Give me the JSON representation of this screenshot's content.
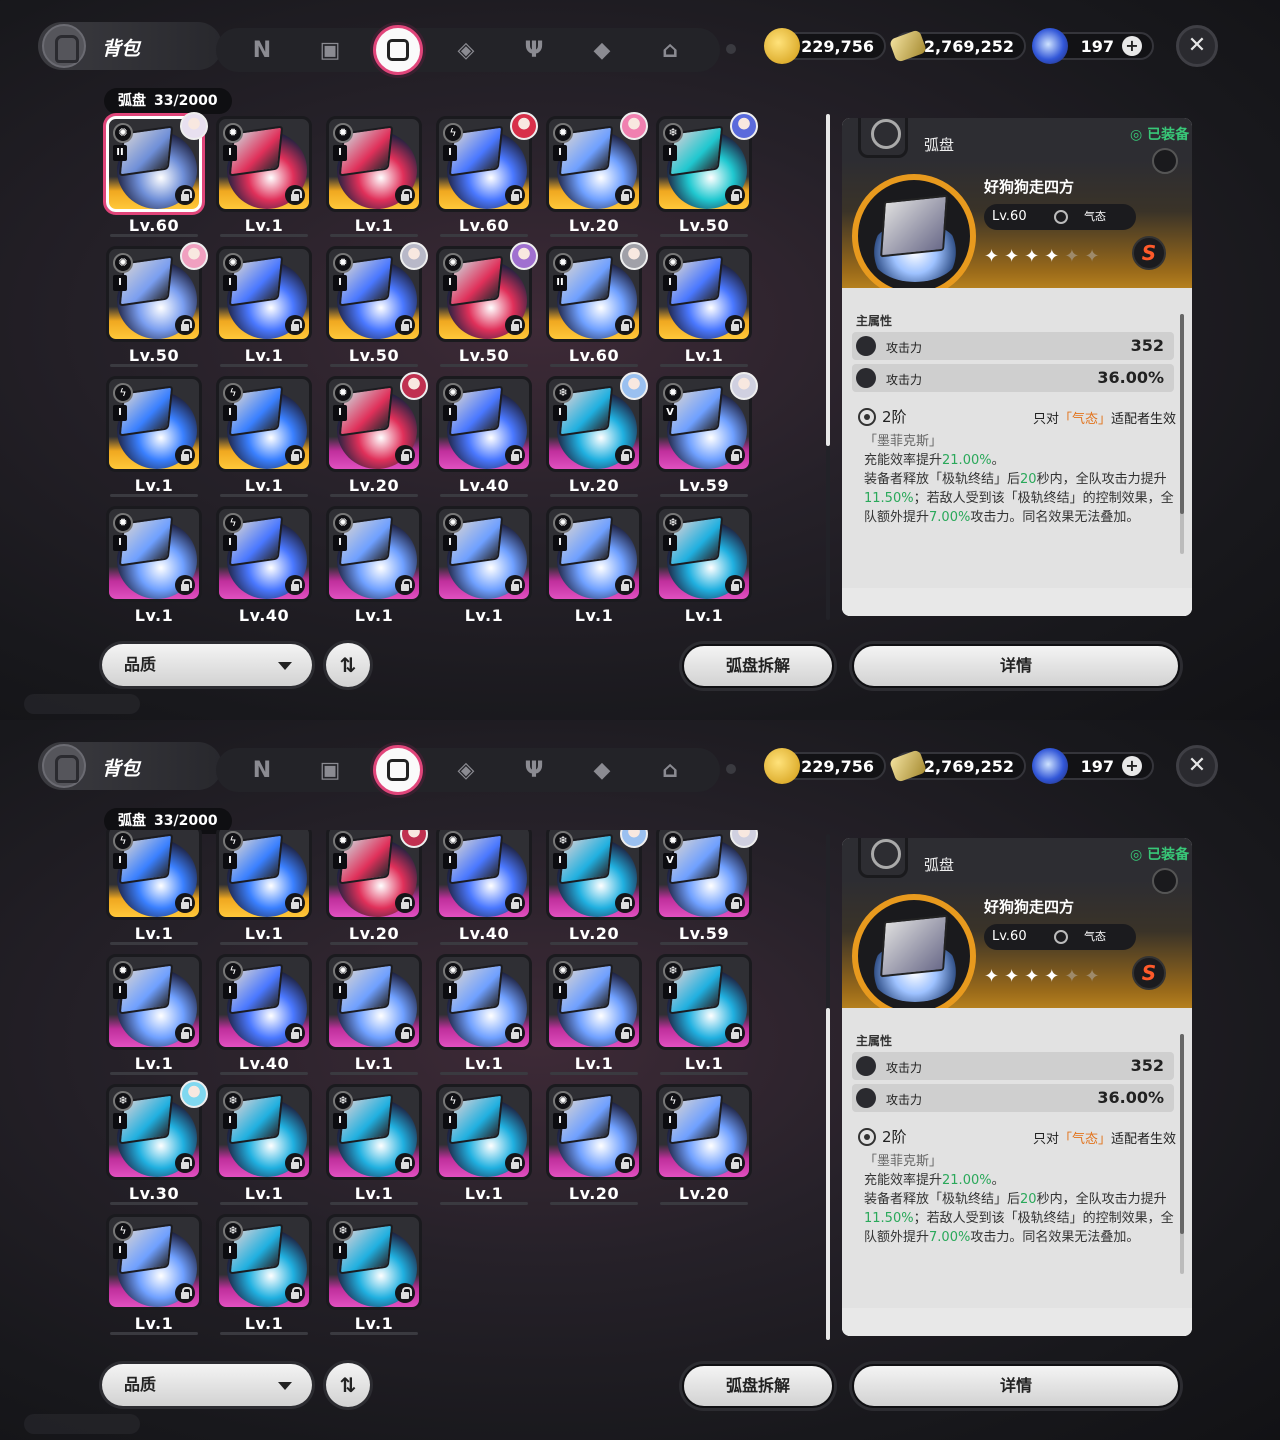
{
  "header": {
    "title": "背包",
    "tabs": [
      {
        "name": "tab-agents",
        "icon": "n-logo-icon",
        "glyph": "N"
      },
      {
        "name": "tab-device",
        "icon": "gameboy-icon",
        "glyph": ""
      },
      {
        "name": "tab-discs",
        "icon": "disc-drive-icon",
        "glyph": "",
        "active": true
      },
      {
        "name": "tab-materials",
        "icon": "cube-icon",
        "glyph": ""
      },
      {
        "name": "tab-food",
        "icon": "fork-knife-icon",
        "glyph": ""
      },
      {
        "name": "tab-bangboo",
        "icon": "box-stack-icon",
        "glyph": ""
      },
      {
        "name": "tab-home",
        "icon": "house-icon",
        "glyph": ""
      }
    ],
    "currencies": [
      {
        "name": "dennies",
        "icon": "gold-coin-icon",
        "value": "229,756"
      },
      {
        "name": "ticket",
        "icon": "ticket-icon",
        "value": "2,769,252"
      },
      {
        "name": "polychrome",
        "icon": "blue-gem-icon",
        "value": "197",
        "plus": "+"
      }
    ],
    "close_label": "✕"
  },
  "inventory": {
    "category": "弧盘",
    "count": "33/2000",
    "items": [
      {
        "level": "Lv.60",
        "grade": "A",
        "rank": "II",
        "hue": "#6f8fd8",
        "avatar": "#e8e0f0",
        "attr": "ether"
      },
      {
        "level": "Lv.1",
        "grade": "A",
        "rank": "I",
        "hue": "#e0305a",
        "attr": "physical"
      },
      {
        "level": "Lv.1",
        "grade": "A",
        "rank": "I",
        "hue": "#e0305a",
        "attr": "physical"
      },
      {
        "level": "Lv.60",
        "grade": "A",
        "rank": "I",
        "hue": "#4a78ff",
        "avatar": "#d8304a",
        "attr": "electric"
      },
      {
        "level": "Lv.20",
        "grade": "A",
        "rank": "I",
        "hue": "#6fa0ff",
        "avatar": "#f080b0",
        "attr": "physical"
      },
      {
        "level": "Lv.50",
        "grade": "A",
        "rank": "I",
        "hue": "#20c8d0",
        "avatar": "#5a6adc",
        "attr": "ice"
      },
      {
        "level": "Lv.50",
        "grade": "A",
        "rank": "I",
        "hue": "#7a9ef0",
        "avatar": "#f0a0c0",
        "attr": "ether"
      },
      {
        "level": "Lv.1",
        "grade": "A",
        "rank": "I",
        "hue": "#4a78ff",
        "attr": "ether"
      },
      {
        "level": "Lv.50",
        "grade": "A",
        "rank": "I",
        "hue": "#4a78ff",
        "avatar": "#b8b8c8",
        "attr": "physical"
      },
      {
        "level": "Lv.50",
        "grade": "A",
        "rank": "I",
        "hue": "#e0305a",
        "avatar": "#a070d0",
        "attr": "ether"
      },
      {
        "level": "Lv.60",
        "grade": "A",
        "rank": "II",
        "hue": "#6fa0ff",
        "avatar": "#a0a0a8",
        "attr": "physical"
      },
      {
        "level": "Lv.1",
        "grade": "A",
        "rank": "I",
        "hue": "#4a78ff",
        "attr": "ether"
      },
      {
        "level": "Lv.1",
        "grade": "A",
        "rank": "I",
        "hue": "#3a80ff",
        "attr": "electric"
      },
      {
        "level": "Lv.1",
        "grade": "A",
        "rank": "I",
        "hue": "#3a80ff",
        "attr": "electric"
      },
      {
        "level": "Lv.20",
        "grade": "S",
        "rank": "I",
        "hue": "#e0305a",
        "avatar": "#c03050",
        "attr": "physical"
      },
      {
        "level": "Lv.40",
        "grade": "S",
        "rank": "I",
        "hue": "#4a78ff",
        "attr": "ether"
      },
      {
        "level": "Lv.20",
        "grade": "S",
        "rank": "I",
        "hue": "#20b0e0",
        "avatar": "#9ac0f0",
        "attr": "ice"
      },
      {
        "level": "Lv.59",
        "grade": "S",
        "rank": "V",
        "hue": "#6fa0ff",
        "avatar": "#d0d0e0",
        "attr": "physical"
      },
      {
        "level": "Lv.1",
        "grade": "S",
        "rank": "I",
        "hue": "#6fa0ff",
        "attr": "physical"
      },
      {
        "level": "Lv.40",
        "grade": "S",
        "rank": "I",
        "hue": "#4a78ff",
        "attr": "electric"
      },
      {
        "level": "Lv.1",
        "grade": "S",
        "rank": "I",
        "hue": "#6fa0ff",
        "attr": "ether"
      },
      {
        "level": "Lv.1",
        "grade": "S",
        "rank": "I",
        "hue": "#6fa0ff",
        "attr": "ether"
      },
      {
        "level": "Lv.1",
        "grade": "S",
        "rank": "I",
        "hue": "#6fa0ff",
        "attr": "ether"
      },
      {
        "level": "Lv.1",
        "grade": "S",
        "rank": "I",
        "hue": "#20b0e0",
        "attr": "ice"
      },
      {
        "level": "Lv.30",
        "grade": "S",
        "rank": "I",
        "hue": "#20b0e0",
        "avatar": "#80d8f0",
        "attr": "ice"
      },
      {
        "level": "Lv.1",
        "grade": "S",
        "rank": "I",
        "hue": "#20b0e0",
        "attr": "ice"
      },
      {
        "level": "Lv.1",
        "grade": "S",
        "rank": "I",
        "hue": "#20b0e0",
        "attr": "ice"
      },
      {
        "level": "Lv.1",
        "grade": "S",
        "rank": "I",
        "hue": "#20b0e0",
        "attr": "electric"
      },
      {
        "level": "Lv.20",
        "grade": "S",
        "rank": "I",
        "hue": "#6fa0ff",
        "attr": "ether"
      },
      {
        "level": "Lv.20",
        "grade": "S",
        "rank": "I",
        "hue": "#6fa0ff",
        "attr": "electric"
      },
      {
        "level": "Lv.1",
        "grade": "S",
        "rank": "I",
        "hue": "#6fa0ff",
        "attr": "electric"
      },
      {
        "level": "Lv.1",
        "grade": "S",
        "rank": "I",
        "hue": "#20b0e0",
        "attr": "ice"
      },
      {
        "level": "Lv.1",
        "grade": "S",
        "rank": "I",
        "hue": "#20b0e0",
        "attr": "ice"
      }
    ]
  },
  "detail": {
    "type_label": "弧盘",
    "equipped_label": "◎ 已装备",
    "name": "好狗狗走四方",
    "level": "Lv.60",
    "stance": "气态",
    "stars_filled": 4,
    "stars_total": 6,
    "grade_badge": "S",
    "main_stat_label": "主属性",
    "stats": [
      {
        "name": "攻击力",
        "value": "352"
      },
      {
        "name": "攻击力",
        "value": "36.00%"
      }
    ],
    "tier": "2阶",
    "condition_pre": "只对",
    "condition_hl": "「气态」",
    "condition_post": "适配者生效",
    "quote": "「墨菲克斯」",
    "line1_pre": "充能效率提升",
    "line1_v": "21.00%",
    "line1_post": "。",
    "line2_a": "装备者释放「极轨终结」后",
    "line2_v1": "20",
    "line2_b": "秒内，全队攻击力提升",
    "line2_v2": "11.50%",
    "line2_c": "；若敌人受到该「极轨终结」的控制效果，全队额外提升",
    "line2_v3": "7.00%",
    "line2_d": "攻击力。同名效果无法叠加。"
  },
  "footer": {
    "filter_label": "品质",
    "sort_label": "⇅",
    "dismantle_label": "弧盘拆解",
    "details_label": "详情"
  },
  "colors": {
    "accent": "#e0457a",
    "equipped": "#38c878",
    "highlight": "#e2731c",
    "value_green": "#2aa85a",
    "grade_A": "#ffc83a",
    "grade_S": "#e050c0"
  },
  "views": [
    {
      "name": "view-scrolled-top",
      "grid_scroll_fraction": 0.0,
      "selected_index": 0
    },
    {
      "name": "view-scrolled-bottom",
      "grid_scroll_fraction": 1.0,
      "selected_index": -1
    }
  ]
}
